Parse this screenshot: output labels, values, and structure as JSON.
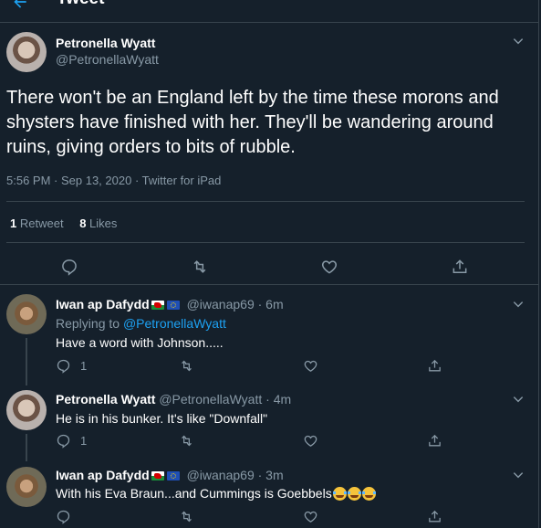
{
  "header": {
    "title": "Tweet"
  },
  "main_tweet": {
    "author_name": "Petronella Wyatt",
    "author_handle": "@PetronellaWyatt",
    "text": "There won't be an England left by the time these morons and shysters have finished with her. They'll be wandering around ruins, giving orders to bits of rubble.",
    "timestamp": "5:56 PM · Sep 13, 2020",
    "separator": "·",
    "source": "Twitter for iPad",
    "retweets_count": "1",
    "retweets_label": "Retweet",
    "likes_count": "8",
    "likes_label": "Likes"
  },
  "replies": [
    {
      "author_name": "Iwan ap Dafydd",
      "author_handle": "@iwanap69",
      "time": "· 6m",
      "replying_to_label": "Replying to",
      "replying_to_handle": "@PetronellaWyatt",
      "text": "Have a word with Johnson.....",
      "reply_count": "1"
    },
    {
      "author_name": "Petronella Wyatt",
      "author_handle": "@PetronellaWyatt",
      "time": "· 4m",
      "text": "He is in his bunker. It's like \"Downfall\"",
      "reply_count": "1"
    },
    {
      "author_name": "Iwan ap Dafydd",
      "author_handle": "@iwanap69",
      "time": "· 3m",
      "text": "With his Eva Braun...and Cummings is Goebbels",
      "reply_count": ""
    }
  ],
  "icons": [
    "back-arrow-icon",
    "chevron-down-icon",
    "reply-icon",
    "retweet-icon",
    "like-icon",
    "share-icon",
    "wales-flag-icon",
    "eu-flag-icon",
    "laughing-emoji-icon"
  ],
  "colors": {
    "background": "#15202b",
    "divider": "#38444d",
    "muted": "#8899a6",
    "link": "#1da1f2"
  }
}
